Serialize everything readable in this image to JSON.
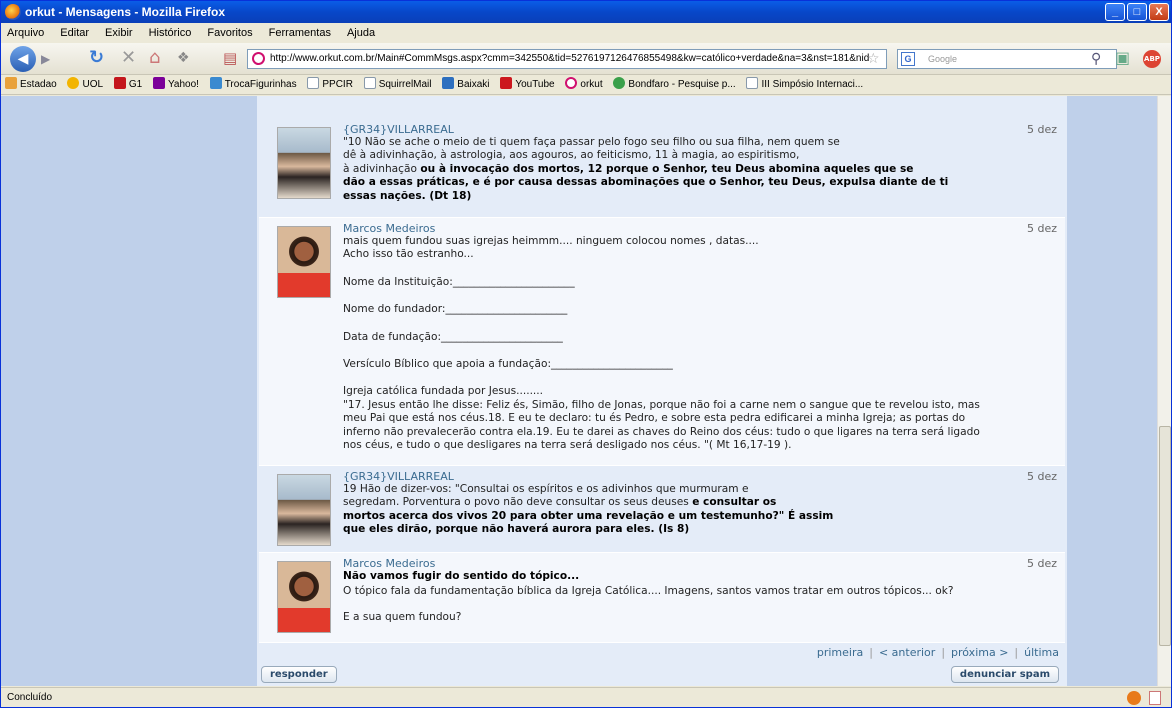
{
  "window": {
    "title": "orkut - Mensagens - Mozilla Firefox",
    "min": "_",
    "max": "□",
    "close": "X"
  },
  "menu": [
    "Arquivo",
    "Editar",
    "Exibir",
    "Histórico",
    "Favoritos",
    "Ferramentas",
    "Ajuda"
  ],
  "nav": {
    "url": "http://www.orkut.com.br/Main#CommMsgs.aspx?cmm=342550&tid=5276197126476855498&kw=católico+verdade&na=3&nst=181&nid",
    "search_placeholder": "Google",
    "abp": "ABP"
  },
  "bookmarks": [
    "Estadao",
    "UOL",
    "G1",
    "Yahoo!",
    "TrocaFigurinhas",
    "PPCIR",
    "SquirrelMail",
    "Baixaki",
    "YouTube",
    "orkut",
    "Bondfaro - Pesquise p...",
    "III Simpósio Internaci..."
  ],
  "posts": [
    {
      "name": "{GR34}VILLARREAL",
      "date": "5 dez",
      "l1": "\"10 Não se ache o meio de ti quem faça passar pelo fogo seu filho ou sua filha, nem quem se",
      "l2": "dê à adivinhação, à astrologia, aos agouros, ao feiticismo, 11 à magia, ao espiritismo,",
      "l3a": "à adivinhação ",
      "l3b": "ou à invocação dos mortos, 12 porque o Senhor, teu Deus abomina aqueles que se",
      "l4": "dão a essas práticas, e é por causa dessas abominações que o Senhor, teu Deus, expulsa diante de ti",
      "l5": "essas nações. (Dt 18)"
    },
    {
      "name": "Marcos Medeiros",
      "date": "5 dez",
      "l1": "mais quem fundou suas igrejas heimmm.... ninguem colocou nomes , datas....",
      "l2": "Acho isso tão estranho...",
      "f1": "Nome da Instituição:_______________________",
      "f2": "Nome do fundador:_______________________",
      "f3": "Data de fundação:_______________________",
      "f4": "Versículo Bíblico que apoia a fundação:_______________________",
      "q1": "Igreja católica fundada por Jesus........",
      "q2": "\"17. Jesus então lhe disse: Feliz és, Simão, filho de Jonas, porque não foi a carne nem o sangue que te revelou isto, mas",
      "q3": "meu Pai que está nos céus.18. E eu te declaro: tu és Pedro, e sobre esta pedra edificarei a minha Igreja; as portas do",
      "q4": "inferno não prevalecerão contra ela.19. Eu te darei as chaves do Reino dos céus: tudo o que ligares na terra será ligado",
      "q5": "nos céus, e tudo o que desligares na terra será desligado nos céus. \"( Mt 16,17-19 )."
    },
    {
      "name": "{GR34}VILLARREAL",
      "date": "5 dez",
      "l1": "19 Hão de dizer-vos: \"Consultai os espíritos e os adivinhos que murmuram e",
      "l2a": "segredam. Porventura o povo não deve consultar os seus deuses ",
      "l2b": "e consultar os",
      "l3": "mortos acerca dos vivos 20 para obter uma revelação e um testemunho?\" É assim",
      "l4": "que eles dirão, porque não haverá aurora para eles. (Is 8)"
    },
    {
      "name": "Marcos Medeiros",
      "date": "5 dez",
      "l1": "Não vamos fugir do sentido do tópico...",
      "l2": "O tópico fala da fundamentação bíblica da Igreja Católica.... Imagens, santos vamos tratar em outros tópicos... ok?",
      "l3": "E a sua quem fundou?"
    }
  ],
  "pager": {
    "first": "primeira",
    "prev": "< anterior",
    "next": "próxima >",
    "last": "última",
    "sep": "|"
  },
  "buttons": {
    "reply": "responder",
    "spam": "denunciar spam"
  },
  "status": "Concluído"
}
